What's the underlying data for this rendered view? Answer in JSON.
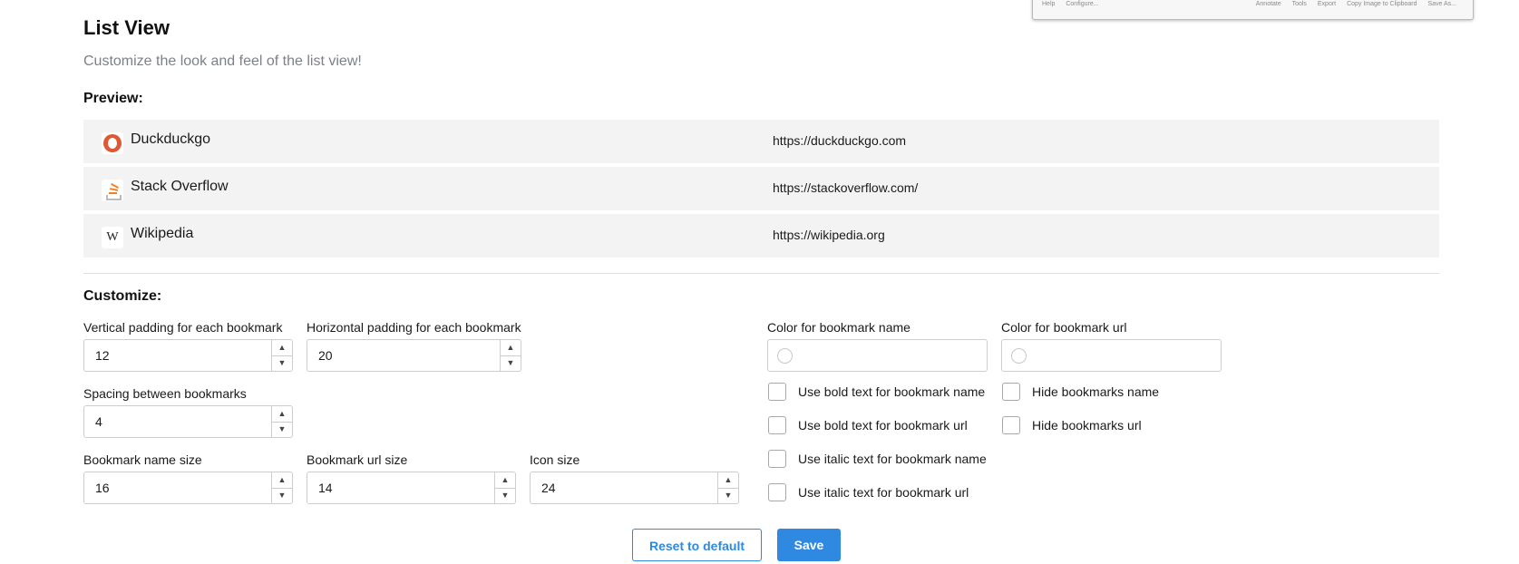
{
  "thumbnail": {
    "left_items": [
      "Help",
      "Configure..."
    ],
    "right_items": [
      "Annotate",
      "Tools",
      "Export",
      "Copy Image to Clipboard",
      "Save As..."
    ]
  },
  "header": {
    "title": "List View",
    "subtitle": "Customize the look and feel of the list view!"
  },
  "preview": {
    "label": "Preview:",
    "rows": [
      {
        "name": "Duckduckgo",
        "url": "https://duckduckgo.com",
        "icon": "duckduckgo-icon"
      },
      {
        "name": "Stack Overflow",
        "url": "https://stackoverflow.com/",
        "icon": "stackoverflow-icon"
      },
      {
        "name": "Wikipedia",
        "url": "https://wikipedia.org",
        "icon": "wikipedia-icon",
        "glyph": "W"
      }
    ]
  },
  "customize": {
    "label": "Customize:",
    "vertical_padding": {
      "label": "Vertical padding for each bookmark",
      "value": "12"
    },
    "horizontal_padding": {
      "label": "Horizontal padding for each bookmark",
      "value": "20"
    },
    "spacing": {
      "label": "Spacing between bookmarks",
      "value": "4"
    },
    "name_size": {
      "label": "Bookmark name size",
      "value": "16"
    },
    "url_size": {
      "label": "Bookmark url size",
      "value": "14"
    },
    "icon_size": {
      "label": "Icon size",
      "value": "24"
    },
    "name_color": {
      "label": "Color for bookmark name"
    },
    "url_color": {
      "label": "Color for bookmark url"
    },
    "checkboxes": {
      "bold_name": "Use bold text for bookmark name",
      "bold_url": "Use bold text for bookmark url",
      "italic_name": "Use italic text for bookmark name",
      "italic_url": "Use italic text for bookmark url",
      "hide_name": "Hide bookmarks name",
      "hide_url": "Hide bookmarks url"
    }
  },
  "actions": {
    "reset_label": "Reset to default",
    "save_label": "Save"
  },
  "colors": {
    "accent": "#2f89e0",
    "row_background": "#f3f3f3",
    "subtitle_text": "#7c8089"
  }
}
